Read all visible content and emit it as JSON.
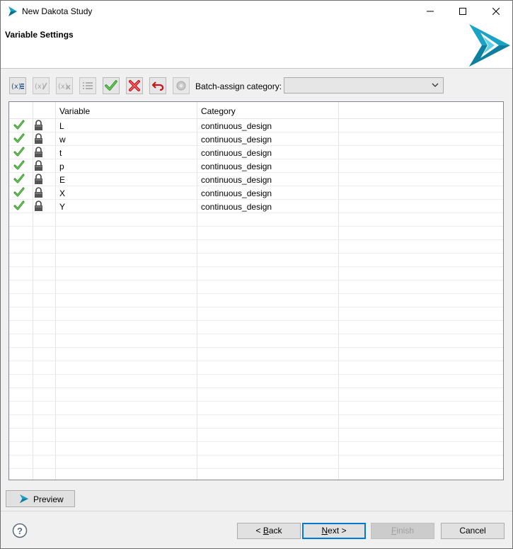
{
  "window": {
    "title": "New Dakota Study"
  },
  "banner": {
    "title": "Variable Settings"
  },
  "toolbar": {
    "buttons": [
      {
        "icon": "variable-insert-icon",
        "enabled": true
      },
      {
        "icon": "variable-edit-icon",
        "enabled": false
      },
      {
        "icon": "variable-remove-icon",
        "enabled": false
      },
      {
        "icon": "list-icon",
        "enabled": false
      },
      {
        "icon": "check-all-icon",
        "enabled": true
      },
      {
        "icon": "uncheck-all-icon",
        "enabled": true
      },
      {
        "icon": "undo-icon",
        "enabled": true
      },
      {
        "icon": "settings-icon",
        "enabled": false
      }
    ],
    "batch_label": "Batch-assign category:",
    "batch_value": ""
  },
  "table": {
    "headers": {
      "variable": "Variable",
      "category": "Category"
    },
    "rows": [
      {
        "variable": "L",
        "category": "continuous_design"
      },
      {
        "variable": "w",
        "category": "continuous_design"
      },
      {
        "variable": "t",
        "category": "continuous_design"
      },
      {
        "variable": "p",
        "category": "continuous_design"
      },
      {
        "variable": "E",
        "category": "continuous_design"
      },
      {
        "variable": "X",
        "category": "continuous_design"
      },
      {
        "variable": "Y",
        "category": "continuous_design"
      }
    ]
  },
  "footer": {
    "preview": "Preview",
    "back_mnemonic": "B",
    "back_rest": "ack",
    "back_prefix": "< ",
    "next_mnemonic": "N",
    "next_rest": "ext >",
    "finish_mnemonic": "F",
    "finish_rest": "inish",
    "cancel": "Cancel"
  },
  "colors": {
    "accent": "#0078d7",
    "logo": "#1aa3c4",
    "check": "#3aa832",
    "remove": "#d9262b"
  }
}
